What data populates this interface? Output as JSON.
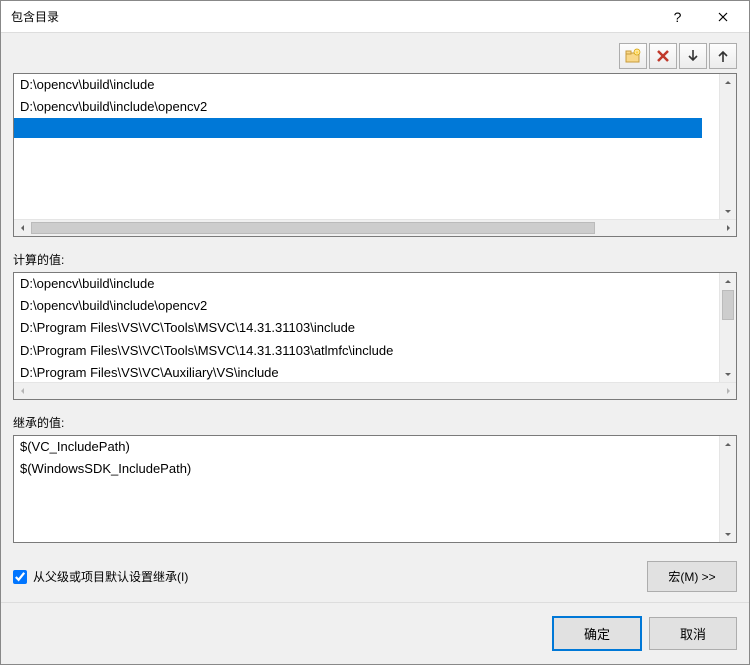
{
  "title": "包含目录",
  "toolbar": {
    "new_folder": "new-line",
    "delete": "delete",
    "move_down": "move-down",
    "move_up": "move-up"
  },
  "user_paths": [
    "D:\\opencv\\build\\include",
    "D:\\opencv\\build\\include\\opencv2"
  ],
  "selected_index": 2,
  "computed_label": "计算的值:",
  "computed_paths": [
    "D:\\opencv\\build\\include",
    "D:\\opencv\\build\\include\\opencv2",
    "D:\\Program Files\\VS\\VC\\Tools\\MSVC\\14.31.31103\\include",
    "D:\\Program Files\\VS\\VC\\Tools\\MSVC\\14.31.31103\\atlmfc\\include",
    "D:\\Program Files\\VS\\VC\\Auxiliary\\VS\\include"
  ],
  "inherited_label": "继承的值:",
  "inherited_values": [
    "$(VC_IncludePath)",
    "$(WindowsSDK_IncludePath)"
  ],
  "inherit_checkbox_label": "从父级或项目默认设置继承(I)",
  "inherit_checked": true,
  "macro_button": "宏(M) >>",
  "ok_button": "确定",
  "cancel_button": "取消",
  "help_char": "?"
}
